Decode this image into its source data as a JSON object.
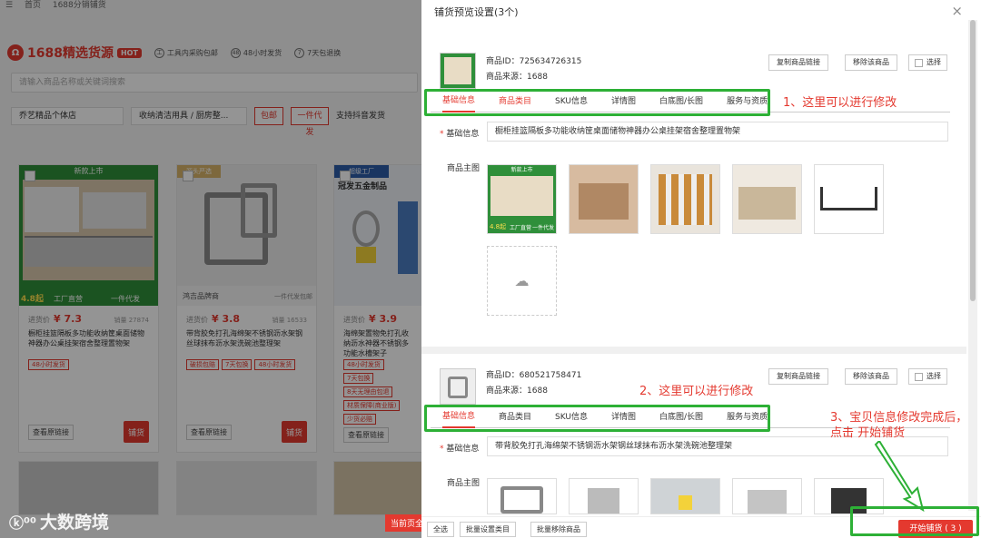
{
  "bg": {
    "breadcrumb": [
      "首页",
      "1688分销铺货"
    ],
    "logo": "1688精选货源",
    "hot": "HOT",
    "features": [
      {
        "icon": "工",
        "text": "工具内采购包邮"
      },
      {
        "icon": "48",
        "text": "48小时发货"
      },
      {
        "icon": "7",
        "text": "7天包退换"
      }
    ],
    "search_placeholder": "请输入商品名称或关键词搜索",
    "filters": {
      "shop": "乔艺精品个体店",
      "category": "收纳清洁用具 / 厨房整...",
      "pill1": "包邮",
      "pill2": "一件代发",
      "text": "支持抖音发货"
    },
    "cards": [
      {
        "price_label": "进货价",
        "price": "¥ 7.3",
        "sales": "销量 27874",
        "title": "橱柜挂篮隔板多功能收纳筐桌面储物神器办公桌挂架宿舍整理置物架",
        "tags": [
          "48小时发货"
        ],
        "link": "查看原链接",
        "btn": "铺货",
        "banner_top": "新款上市",
        "banner_bot1": "工厂直营",
        "banner_bot2": "一件代发",
        "price_badge": "4.8起"
      },
      {
        "price_label": "进货价",
        "price": "¥ 3.8",
        "sales": "销量 16533",
        "title": "带背胶免打孔海绵架不锈钢沥水架钢丝球抹布沥水架洗碗池整理架",
        "tags": [
          "破损包赔",
          "7天包换",
          "48小时发货"
        ],
        "link": "查看原链接",
        "btn": "铺货",
        "banner_top": "源头严选",
        "banner_bot1": "鸿吉品牌商",
        "banner_bot2": "一件代发包邮"
      },
      {
        "price_label": "进货价",
        "price": "¥ 3.9",
        "sales": "",
        "title": "海绵架置物免打孔收纳沥水神器不锈钢多功能水槽架子",
        "tags": [
          "48小时发货",
          "7天包换",
          "8天无理由包退",
          "材质保障(商业版)",
          "少货必赔"
        ],
        "link": "查看原链接",
        "btn": "铺货",
        "banner_top": "超级工厂",
        "banner_bot1": "冠发五金制品",
        "banner_bot2": ""
      }
    ],
    "next_btn": "当前页全",
    "watermark": "大数跨境"
  },
  "modal": {
    "title": "铺货预览设置(3个)",
    "close": "×",
    "items": [
      {
        "id_label": "商品ID：",
        "id": "725634726315",
        "src_label": "商品来源：",
        "src": "1688",
        "copy": "复制商品链接",
        "remove": "移除该商品",
        "select": "选择",
        "tabs": [
          "基础信息",
          "商品类目",
          "SKU信息",
          "详情图",
          "白底图/长图",
          "服务与资质"
        ],
        "title_label": "基础信息",
        "title_value": "橱柜挂篮隔板多功能收纳筐桌面储物神器办公桌挂架宿舍整理置物架",
        "image_label": "商品主图",
        "annotation": "1、这里可以进行修改"
      },
      {
        "id_label": "商品ID：",
        "id": "680521758471",
        "src_label": "商品来源：",
        "src": "1688",
        "copy": "复制商品链接",
        "remove": "移除该商品",
        "select": "选择",
        "tabs": [
          "基础信息",
          "商品类目",
          "SKU信息",
          "详情图",
          "白底图/长图",
          "服务与资质"
        ],
        "title_label": "基础信息",
        "title_value": "带背胶免打孔海绵架不锈钢沥水架钢丝球抹布沥水架洗碗池整理架",
        "image_label": "商品主图",
        "annotation": "2、这里可以进行修改"
      }
    ],
    "img_badge1": "新款上市",
    "img_badge2": "工厂直营",
    "img_badge3": "一件代发",
    "img_price": "4.8起",
    "annotation3": "3、宝贝信息修改完成后，点击  开始铺货",
    "footer": {
      "all": "全选",
      "batch_cat": "批量设置类目",
      "batch_remove": "批量移除商品",
      "start": "开始铺货 ( 3 )"
    }
  },
  "colors": {
    "accent": "#e4392f",
    "annotation_green": "#2db036"
  }
}
